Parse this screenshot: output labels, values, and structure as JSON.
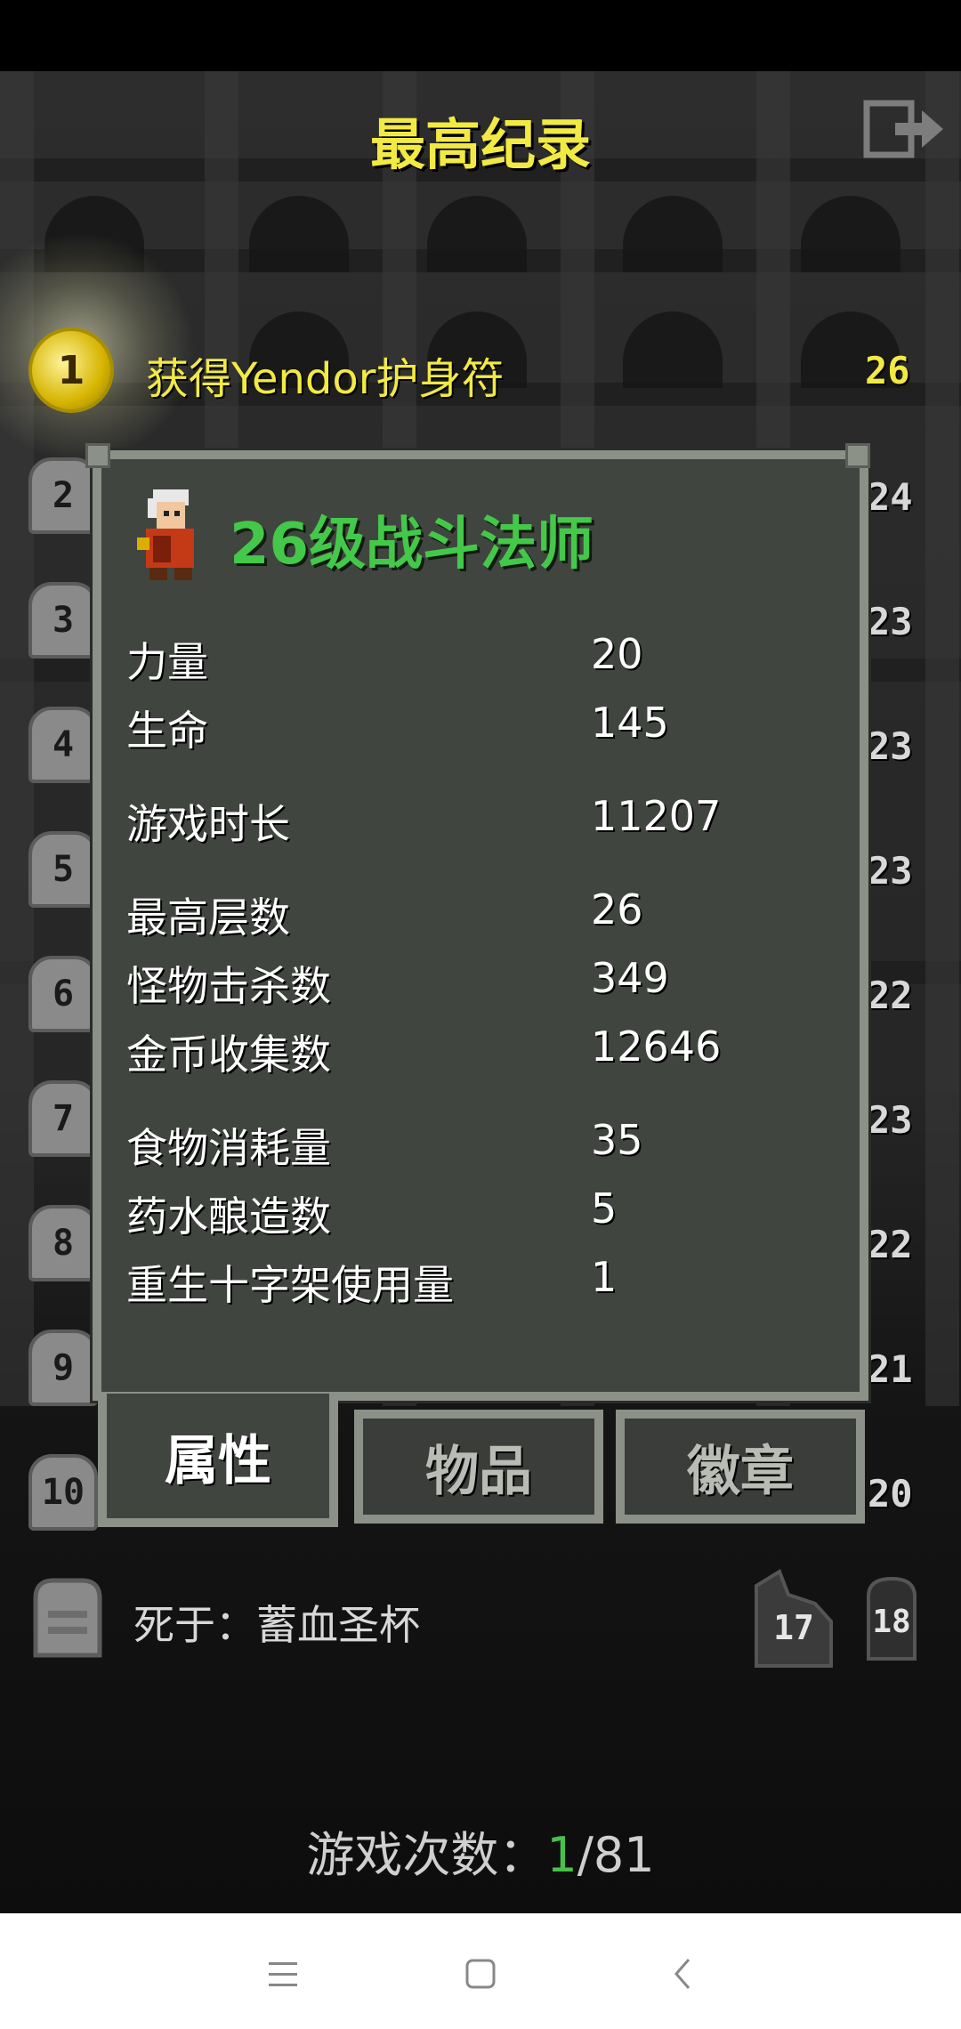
{
  "header": {
    "title": "最高纪录"
  },
  "rank1": {
    "rank": "1",
    "description": "获得Yendor护身符",
    "level": "26"
  },
  "side_ranks": [
    {
      "rank": "2",
      "level": "24"
    },
    {
      "rank": "3",
      "level": "23"
    },
    {
      "rank": "4",
      "level": "23"
    },
    {
      "rank": "5",
      "level": "23"
    },
    {
      "rank": "6",
      "level": "22"
    },
    {
      "rank": "7",
      "level": "23"
    },
    {
      "rank": "8",
      "level": "22"
    },
    {
      "rank": "9",
      "level": "21"
    },
    {
      "rank": "10",
      "level": "20"
    }
  ],
  "dialog": {
    "hero_title": "26级战斗法师",
    "stats": [
      {
        "label": "力量",
        "value": "20"
      },
      {
        "label": "生命",
        "value": "145"
      },
      {
        "label": "游戏时长",
        "value": "11207"
      },
      {
        "label": "最高层数",
        "value": "26"
      },
      {
        "label": "怪物击杀数",
        "value": "349"
      },
      {
        "label": "金币收集数",
        "value": "12646"
      },
      {
        "label": "食物消耗量",
        "value": "35"
      },
      {
        "label": "药水酿造数",
        "value": "5"
      },
      {
        "label": "重生十字架使用量",
        "value": "1"
      }
    ],
    "tabs": {
      "attributes": "属性",
      "items": "物品",
      "badges": "徽章"
    }
  },
  "bottom": {
    "death_text": "死于：蓄血圣杯",
    "grave_a_level": "17",
    "grave_b_level": "18",
    "games_label": "游戏次数：",
    "games_current": "1",
    "games_total": "/81"
  },
  "colors": {
    "title": "#f2ea43",
    "hero": "#44c84a",
    "panel": "#414540",
    "frame": "#8c9188"
  },
  "icons": [
    "exit-icon",
    "amulet-medal-icon",
    "tombstone-icon",
    "battle-mage-hero-icon",
    "menu-icon",
    "home-icon",
    "back-icon"
  ]
}
